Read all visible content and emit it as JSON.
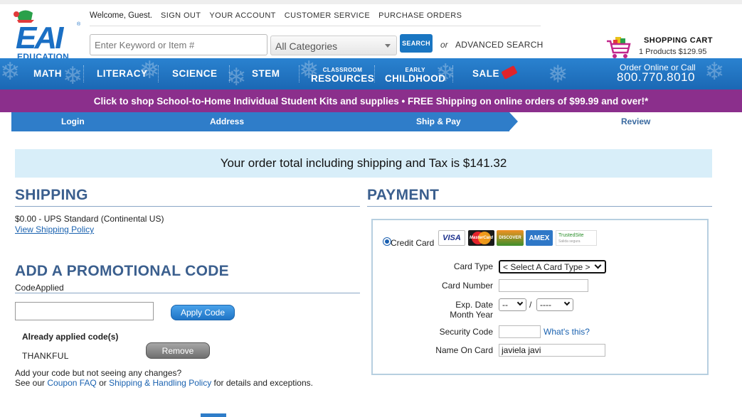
{
  "header": {
    "logo_text": "EAI EDUCATION",
    "welcome": "Welcome, Guest.",
    "links": [
      "SIGN OUT",
      "YOUR ACCOUNT",
      "CUSTOMER SERVICE",
      "PURCHASE ORDERS"
    ],
    "search_placeholder": "Enter Keyword or Item #",
    "category": "All Categories",
    "search_button": "SEARCH",
    "or": "or",
    "advanced_search": "ADVANCED SEARCH",
    "cart_title": "SHOPPING CART",
    "cart_summary": "1 Products $129.95"
  },
  "mainnav": {
    "math": "MATH",
    "literacy": "LITERACY",
    "science": "SCIENCE",
    "stem": "STEM",
    "classroom_small": "CLASSROOM",
    "classroom_big": "RESOURCES",
    "early_small": "EARLY",
    "early_big": "CHILDHOOD",
    "sale": "SALE",
    "order_online": "Order Online or Call",
    "phone": "800.770.8010"
  },
  "promo_banner": "Click to shop School-to-Home Individual Student Kits and supplies  •  FREE Shipping on online orders of $99.99 and over!*",
  "steps": {
    "login": "Login",
    "address": "Address",
    "ship_pay": "Ship & Pay",
    "review": "Review"
  },
  "order_total": "Your order total including shipping and Tax is $141.32",
  "shipping": {
    "title": "SHIPPING",
    "method": "$0.00 - UPS Standard (Continental US)",
    "policy_link": "View Shipping Policy"
  },
  "promo_code": {
    "title": "ADD A PROMOTIONAL CODE",
    "label": "CodeApplied",
    "apply_button": "Apply Code",
    "already_label": "Already applied code(s)",
    "applied_code": "THANKFUL",
    "remove_button": "Remove",
    "help_line1": "Add your code but not seeing any changes?",
    "help_see": "See our",
    "coupon_faq": "Coupon FAQ",
    "or": "or",
    "shipping_policy": "Shipping & Handling Policy",
    "help_tail": "for details and exceptions."
  },
  "payment": {
    "title": "PAYMENT",
    "credit_card": "Credit Card",
    "cards": [
      "VISA",
      "MasterCard",
      "DISCOVER",
      "AMEX"
    ],
    "trusted_site": "TrustedSite",
    "trusted_sub": "Salida segura",
    "card_type_label": "Card Type",
    "card_type_value": "< Select A Card Type >",
    "card_number_label": "Card Number",
    "exp_label_1": "Exp. Date",
    "exp_label_2": "Month Year",
    "exp_month": "--",
    "exp_slash": "/",
    "exp_year": "----",
    "security_label": "Security Code",
    "whats_this": "What's this?",
    "name_label": "Name On Card",
    "name_value": "javiela javi"
  },
  "colors": {
    "nav_blue": "#1f72c0",
    "promo_purple": "#8b2f8c",
    "section_title": "#3b5f8e",
    "total_bg": "#d8eef9"
  }
}
